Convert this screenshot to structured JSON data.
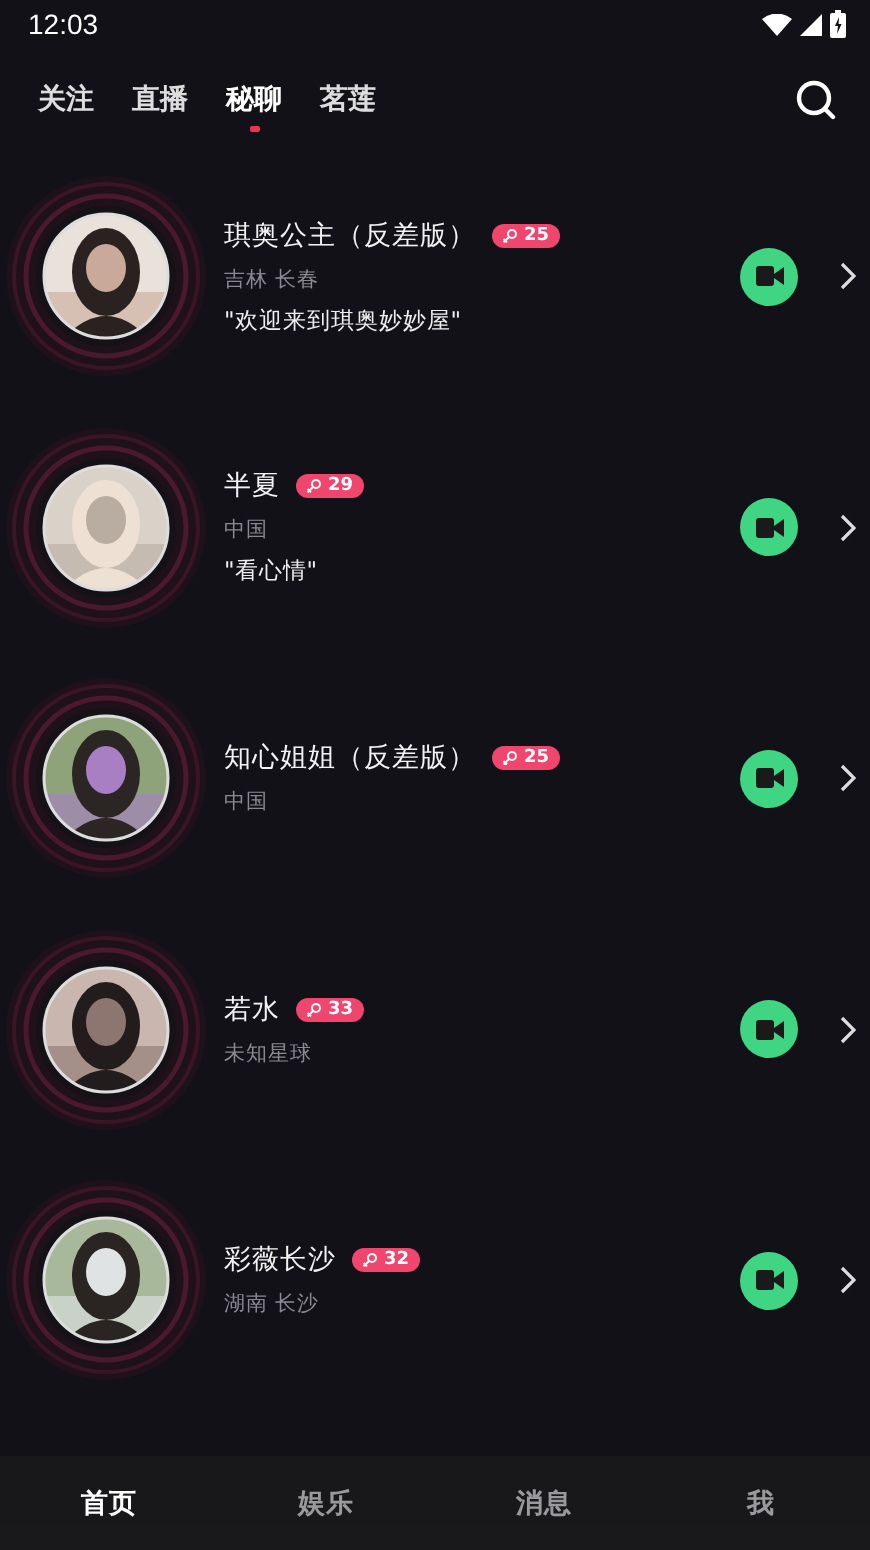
{
  "status_bar": {
    "time": "12:03"
  },
  "tabs": [
    {
      "label": "关注",
      "selected": false
    },
    {
      "label": "直播",
      "selected": false
    },
    {
      "label": "秘聊",
      "selected": true
    },
    {
      "label": "茗莲",
      "selected": false
    }
  ],
  "users": [
    {
      "name": "琪奥公主（反差版）",
      "age": "25",
      "location": "吉林 长春",
      "signature": "\"欢迎来到琪奥妙妙屋\""
    },
    {
      "name": "半夏",
      "age": "29",
      "location": "中国",
      "signature": "\"看心情\""
    },
    {
      "name": "知心姐姐（反差版）",
      "age": "25",
      "location": "中国"
    },
    {
      "name": "若水",
      "age": "33",
      "location": "未知星球"
    },
    {
      "name": "彩薇长沙",
      "age": "32",
      "location": "湖南 长沙"
    }
  ],
  "bottom_nav": [
    {
      "label": "首页",
      "selected": true
    },
    {
      "label": "娱乐",
      "selected": false
    },
    {
      "label": "消息",
      "selected": false
    },
    {
      "label": "我",
      "selected": false
    }
  ]
}
